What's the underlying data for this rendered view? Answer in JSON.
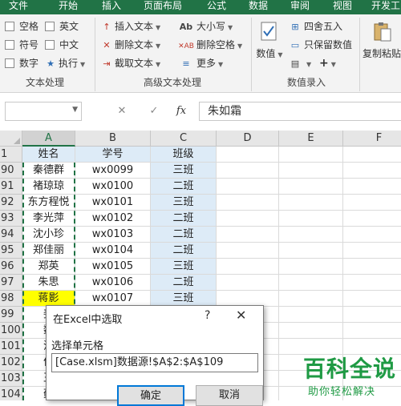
{
  "ribbon_tabs": [
    {
      "label": "文件",
      "active": false
    },
    {
      "label": "开始",
      "active": false
    },
    {
      "label": "插入",
      "active": false
    },
    {
      "label": "页面布局",
      "active": false
    },
    {
      "label": "公式",
      "active": false
    },
    {
      "label": "数据",
      "active": false
    },
    {
      "label": "审阅",
      "active": false
    },
    {
      "label": "视图",
      "active": false
    },
    {
      "label": "开发工",
      "active": false
    }
  ],
  "groups": {
    "text_processing": {
      "label": "文本处理",
      "items": [
        "空格",
        "英文",
        "符号",
        "中文",
        "数字",
        "执行"
      ]
    },
    "advanced_text": {
      "label": "高级文本处理",
      "items": [
        "插入文本",
        "删除文本",
        "截取文本",
        "大小写",
        "删除空格",
        "更多"
      ]
    },
    "value_entry": {
      "label": "数值录入",
      "items": [
        "数值",
        "四舍五入",
        "只保留数值",
        "+"
      ],
      "copy_paste": "复制粘贴"
    }
  },
  "formula_bar": {
    "cancel": "✕",
    "confirm": "✓",
    "fx": "fx",
    "value": "朱如霜"
  },
  "sheet": {
    "columns": [
      "A",
      "B",
      "C",
      "D",
      "E",
      "F"
    ],
    "header_row": {
      "row": "1",
      "cells": [
        "姓名",
        "学号",
        "班级"
      ]
    },
    "rows": [
      {
        "row": "90",
        "cells": [
          "秦德群",
          "wx0099",
          "三班"
        ]
      },
      {
        "row": "91",
        "cells": [
          "褚琼琼",
          "wx0100",
          "二班"
        ]
      },
      {
        "row": "92",
        "cells": [
          "东方程悦",
          "wx0101",
          "三班"
        ]
      },
      {
        "row": "93",
        "cells": [
          "李光萍",
          "wx0102",
          "二班"
        ]
      },
      {
        "row": "94",
        "cells": [
          "沈小珍",
          "wx0103",
          "二班"
        ]
      },
      {
        "row": "95",
        "cells": [
          "郑佳丽",
          "wx0104",
          "二班"
        ]
      },
      {
        "row": "96",
        "cells": [
          "郑英",
          "wx0105",
          "三班"
        ]
      },
      {
        "row": "97",
        "cells": [
          "朱思",
          "wx0106",
          "二班"
        ]
      },
      {
        "row": "98",
        "cells": [
          "蒋影",
          "wx0107",
          "三班"
        ]
      },
      {
        "row": "99",
        "cells": [
          "姜",
          "",
          ""
        ]
      },
      {
        "row": "100",
        "cells": [
          "魏",
          "",
          ""
        ]
      },
      {
        "row": "101",
        "cells": [
          "沈",
          "",
          ""
        ]
      },
      {
        "row": "102",
        "cells": [
          "何",
          "",
          ""
        ]
      },
      {
        "row": "103",
        "cells": [
          "王",
          "",
          ""
        ]
      },
      {
        "row": "104",
        "cells": [
          "蓟",
          "",
          ""
        ]
      }
    ]
  },
  "dialog": {
    "title": "在Excel中选取",
    "help": "?",
    "close": "✕",
    "label": "选择单元格",
    "value": "[Case.xlsm]数据源!$A$2:$A$109",
    "ok": "确定",
    "cancel": "取消"
  },
  "watermark": {
    "title": "百科全说",
    "subtitle": "助你轻松解决"
  },
  "colors": {
    "excel_green": "#217346",
    "header_blue": "#ddebf7",
    "highlight_yellow": "#ffff00",
    "watermark_green": "#1f9a44"
  }
}
